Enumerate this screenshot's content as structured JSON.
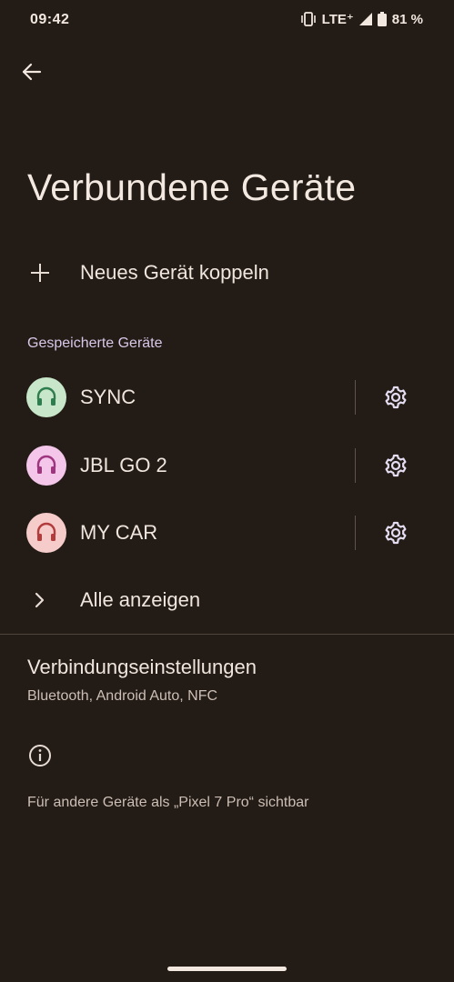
{
  "status_bar": {
    "time": "09:42",
    "network": "LTE⁺",
    "battery": "81 %",
    "icons": [
      "vibrate-icon",
      "signal-icon",
      "battery-icon"
    ]
  },
  "header": {
    "back_icon": "arrow-back-icon",
    "title": "Verbundene Geräte"
  },
  "pair_new": {
    "icon": "plus-icon",
    "label": "Neues Gerät koppeln"
  },
  "saved_devices": {
    "section_label": "Gespeicherte Geräte",
    "items": [
      {
        "name": "SYNC",
        "icon": "headset-icon",
        "avatar_bg": "#c8e6c9",
        "icon_color": "#2e7d4f",
        "settings_icon": "gear-icon"
      },
      {
        "name": "JBL GO 2",
        "icon": "headset-icon",
        "avatar_bg": "#f3c6ea",
        "icon_color": "#a0357f",
        "settings_icon": "gear-icon"
      },
      {
        "name": "MY CAR",
        "icon": "headset-icon",
        "avatar_bg": "#f6cccb",
        "icon_color": "#b23b3b",
        "settings_icon": "gear-icon"
      }
    ]
  },
  "show_all": {
    "icon": "chevron-right-icon",
    "label": "Alle anzeigen"
  },
  "connection_settings": {
    "title": "Verbindungseinstellungen",
    "subtitle": "Bluetooth, Android Auto, NFC"
  },
  "footer": {
    "icon": "info-icon",
    "text": "Für andere Geräte als „Pixel 7 Pro“ sichtbar"
  },
  "colors": {
    "background": "#221b16",
    "text": "#f0e6de",
    "accent_section": "#d9c8e8"
  }
}
